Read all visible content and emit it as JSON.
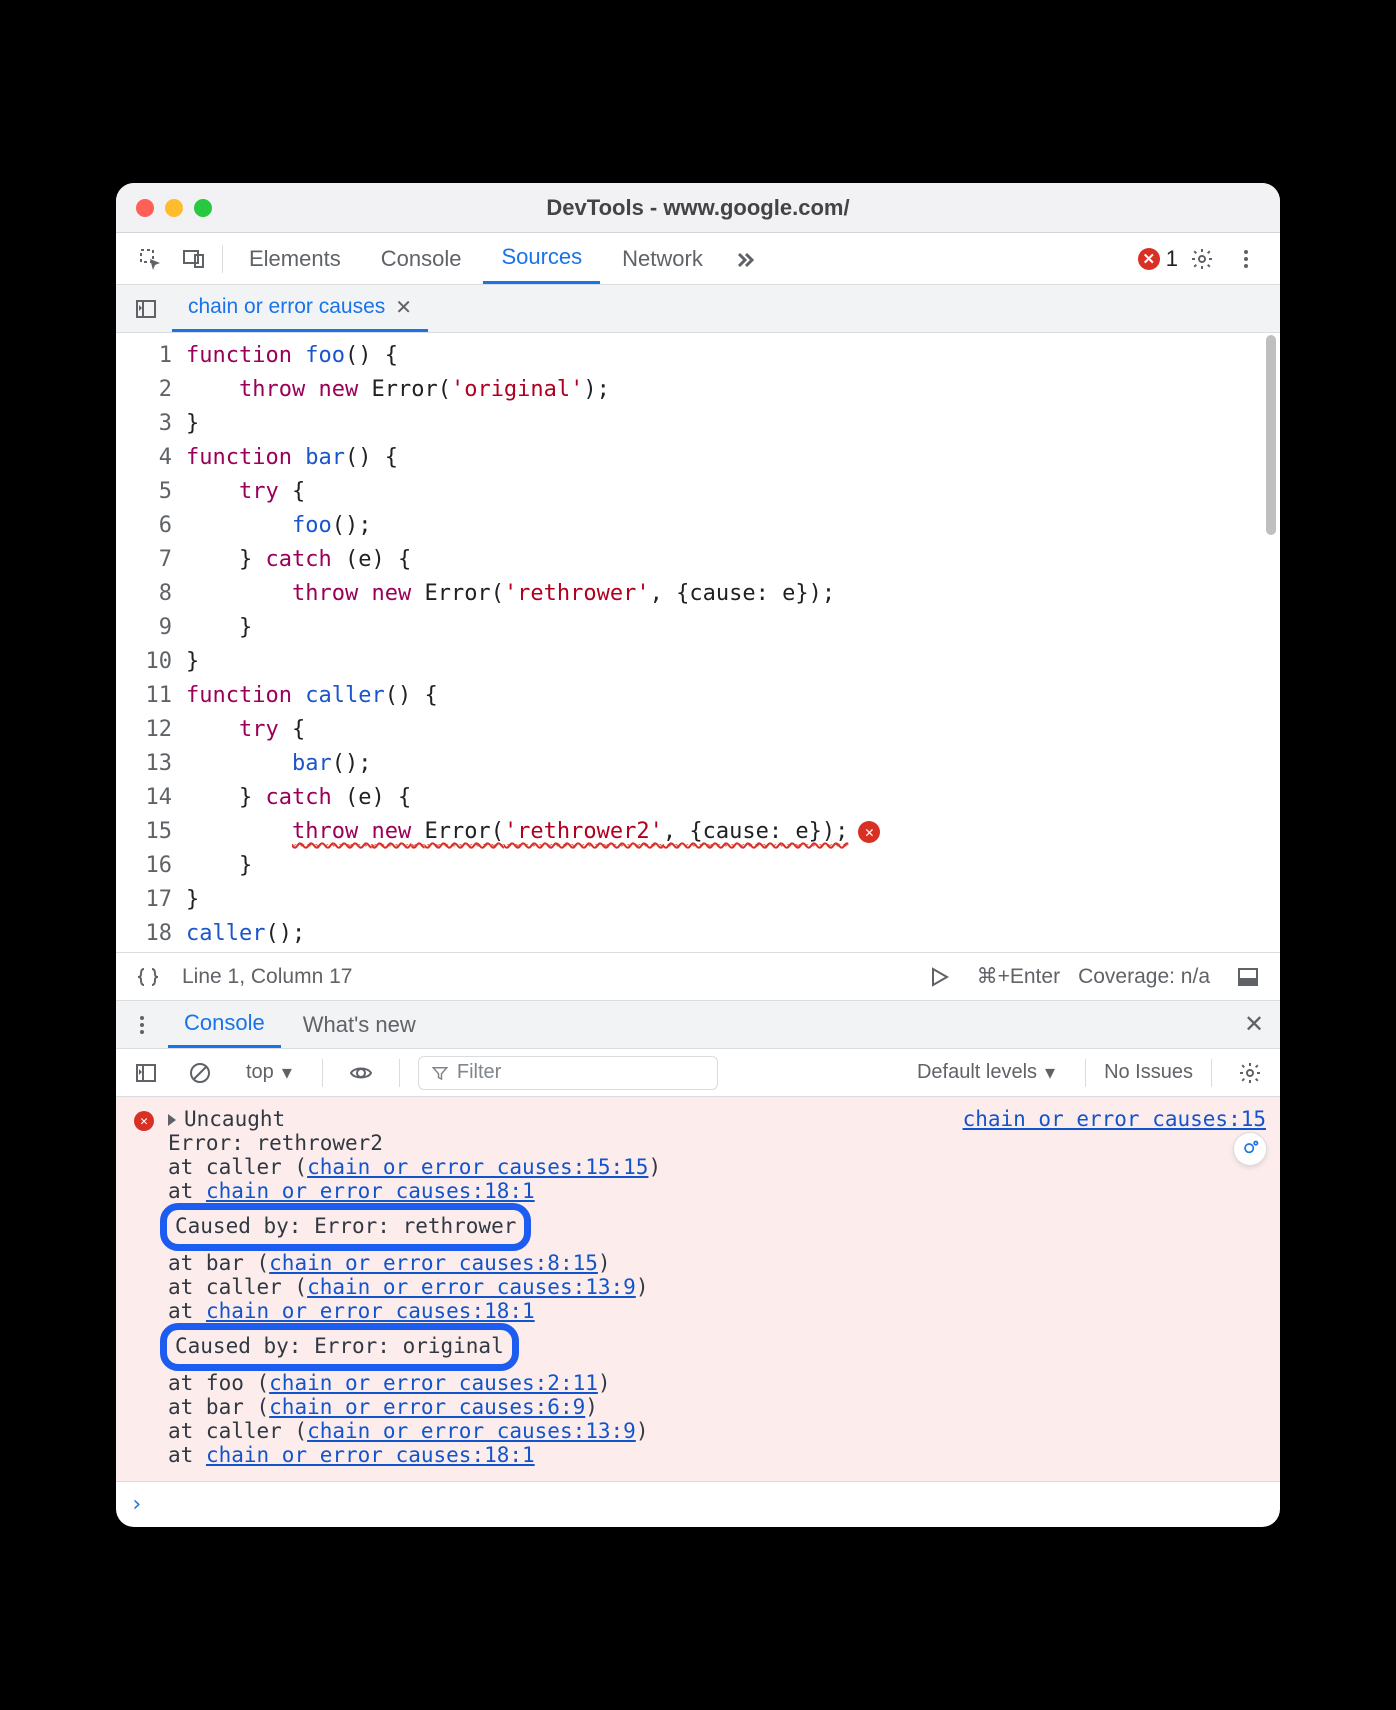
{
  "window": {
    "title": "DevTools - www.google.com/"
  },
  "tabs": {
    "elements": "Elements",
    "console": "Console",
    "sources": "Sources",
    "network": "Network"
  },
  "error_count": "1",
  "open_file_tab": "chain or error causes",
  "code": {
    "lines": [
      {
        "n": "1",
        "html": "<span class='kw'>function</span> <span class='fn'>foo</span>() {"
      },
      {
        "n": "2",
        "html": "    <span class='kw'>throw</span> <span class='kw'>new</span> <span class='type'>Error</span>(<span class='str'>'original'</span>);"
      },
      {
        "n": "3",
        "html": "}"
      },
      {
        "n": "4",
        "html": "<span class='kw'>function</span> <span class='fn'>bar</span>() {"
      },
      {
        "n": "5",
        "html": "    <span class='kw'>try</span> {"
      },
      {
        "n": "6",
        "html": "        <span class='fn'>foo</span>();"
      },
      {
        "n": "7",
        "html": "    } <span class='kw'>catch</span> (e) {"
      },
      {
        "n": "8",
        "html": "        <span class='kw'>throw</span> <span class='kw'>new</span> <span class='type'>Error</span>(<span class='str'>'rethrower'</span>, {cause: e});"
      },
      {
        "n": "9",
        "html": "    }"
      },
      {
        "n": "10",
        "html": "}"
      },
      {
        "n": "11",
        "html": "<span class='kw'>function</span> <span class='fn'>caller</span>() {"
      },
      {
        "n": "12",
        "html": "    <span class='kw'>try</span> {"
      },
      {
        "n": "13",
        "html": "        <span class='fn'>bar</span>();"
      },
      {
        "n": "14",
        "html": "    } <span class='kw'>catch</span> (e) {"
      },
      {
        "n": "15",
        "html": "        <span class='squig'><span class='kw'>throw</span> <span class='kw'>new</span> <span class='type'>Error</span>(<span class='str'>'rethrower2'</span>, {cause: e});</span>",
        "err": true
      },
      {
        "n": "16",
        "html": "    }"
      },
      {
        "n": "17",
        "html": "}"
      },
      {
        "n": "18",
        "html": "<span class='fn'>caller</span>();"
      }
    ]
  },
  "status": {
    "cursor": "Line 1, Column 17",
    "run_hint": "⌘+Enter",
    "coverage": "Coverage: n/a"
  },
  "drawer": {
    "console": "Console",
    "whatsnew": "What's new"
  },
  "console_toolbar": {
    "context": "top",
    "filter_placeholder": "Filter",
    "levels": "Default levels",
    "issues": "No Issues"
  },
  "console_output": {
    "source_link": "chain or error causes:15",
    "head": "Uncaught",
    "err_line": "Error: rethrower2",
    "stack1": [
      {
        "pre": "    at caller (",
        "link": "chain or error causes:15:15",
        "post": ")"
      },
      {
        "pre": "    at ",
        "link": "chain or error causes:18:1",
        "post": ""
      }
    ],
    "cause1": "Caused by: Error: rethrower",
    "stack2": [
      {
        "pre": "    at bar (",
        "link": "chain or error causes:8:15",
        "post": ")"
      },
      {
        "pre": "    at caller (",
        "link": "chain or error causes:13:9",
        "post": ")"
      },
      {
        "pre": "    at ",
        "link": "chain or error causes:18:1",
        "post": ""
      }
    ],
    "cause2": "Caused by: Error: original",
    "stack3": [
      {
        "pre": "    at foo (",
        "link": "chain or error causes:2:11",
        "post": ")"
      },
      {
        "pre": "    at bar (",
        "link": "chain or error causes:6:9",
        "post": ")"
      },
      {
        "pre": "    at caller (",
        "link": "chain or error causes:13:9",
        "post": ")"
      },
      {
        "pre": "    at ",
        "link": "chain or error causes:18:1",
        "post": ""
      }
    ]
  },
  "prompt": "›"
}
